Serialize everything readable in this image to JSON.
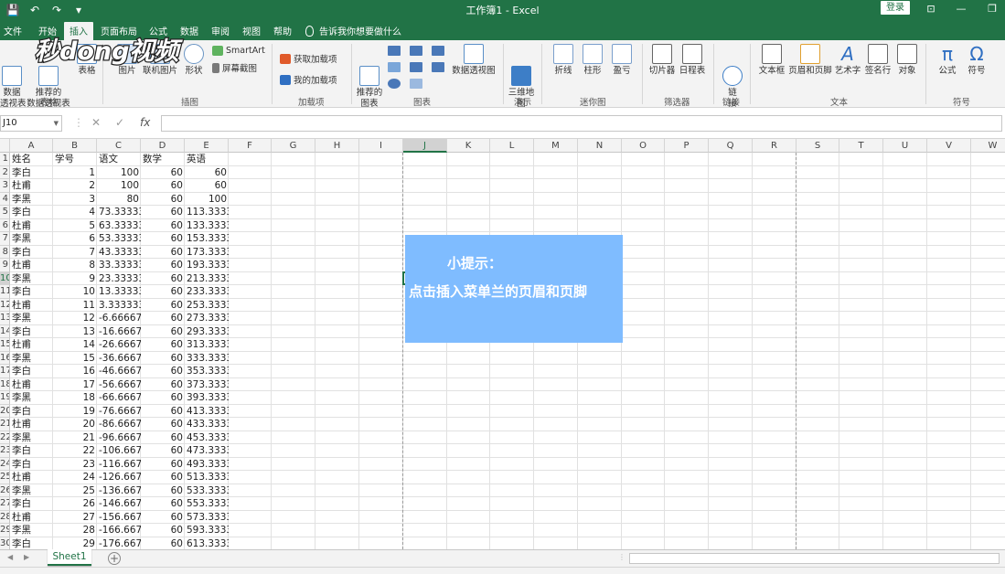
{
  "titlebar": {
    "title": "工作簿1 - Excel",
    "login": "登录",
    "qat": [
      "💾",
      "↶",
      "↷",
      "▾"
    ],
    "win": [
      "⊡",
      "—",
      "❐"
    ]
  },
  "menu": {
    "tabs": [
      "文件",
      "开始",
      "插入",
      "页面布局",
      "公式",
      "数据",
      "审阅",
      "视图",
      "帮助"
    ],
    "tellme": "告诉我你想要做什么"
  },
  "ribbon": {
    "buttons": {
      "pivot": "数据\n透视表",
      "rec_pivot": "推荐的\n数据透视表",
      "table": "表格",
      "picture": "图片",
      "online_pic": "联机图片",
      "shapes": "形状",
      "smartart": "SmartArt",
      "screenshot": "屏幕截图",
      "get_addins": "获取加载项",
      "my_addins": "我的加载项",
      "rec_charts": "推荐的\n图表",
      "pivot_chart": "数据透视图",
      "map3d": "三维地\n图",
      "line": "折线",
      "column": "柱形",
      "winloss": "盈亏",
      "slicer": "切片器",
      "timeline": "日程表",
      "link": "链\n接",
      "textbox": "文本框",
      "header_footer": "页眉和页脚",
      "wordart": "艺术字",
      "signature": "签名行",
      "object": "对象",
      "equation": "公式",
      "symbol": "符号"
    },
    "groups": {
      "tables": "表格",
      "illustrations": "插图",
      "addins": "加载项",
      "charts": "图表",
      "tours": "演示",
      "sparklines": "迷你图",
      "filters": "筛选器",
      "links": "链接",
      "text": "文本",
      "symbols": "符号"
    }
  },
  "logo": {
    "text": "秒dong视频"
  },
  "formula": {
    "namebox": "J10",
    "cancel": "✕",
    "enter": "✓",
    "fx": "fx",
    "value": ""
  },
  "grid": {
    "columns": [
      "A",
      "B",
      "C",
      "D",
      "E",
      "F",
      "G",
      "H",
      "I",
      "J",
      "K",
      "L",
      "M",
      "N",
      "O",
      "P",
      "Q",
      "R",
      "S",
      "T",
      "U",
      "V",
      "W"
    ],
    "row_headers": [
      "1",
      "2",
      "3",
      "4",
      "5",
      "6",
      "7",
      "8",
      "9",
      "10",
      "11",
      "12",
      "13",
      "14",
      "15",
      "16",
      "17",
      "18",
      "19",
      "20",
      "21",
      "22",
      "23",
      "24",
      "25",
      "26",
      "27",
      "28",
      "29",
      "30"
    ],
    "header": [
      "姓名",
      "学号",
      "语文",
      "数学",
      "英语"
    ],
    "rows": [
      [
        "李白",
        "1",
        "100",
        "60",
        "60"
      ],
      [
        "杜甫",
        "2",
        "100",
        "60",
        "60"
      ],
      [
        "李黑",
        "3",
        "80",
        "60",
        "100"
      ],
      [
        "李白",
        "4",
        "73.33333",
        "60",
        "113.3333"
      ],
      [
        "杜甫",
        "5",
        "63.33333",
        "60",
        "133.3333"
      ],
      [
        "李黑",
        "6",
        "53.33333",
        "60",
        "153.3333"
      ],
      [
        "李白",
        "7",
        "43.33333",
        "60",
        "173.3333"
      ],
      [
        "杜甫",
        "8",
        "33.33333",
        "60",
        "193.3333"
      ],
      [
        "李黑",
        "9",
        "23.33333",
        "60",
        "213.3333"
      ],
      [
        "李白",
        "10",
        "13.33333",
        "60",
        "233.3333"
      ],
      [
        "杜甫",
        "11",
        "3.333333",
        "60",
        "253.3333"
      ],
      [
        "李黑",
        "12",
        "-6.66667",
        "60",
        "273.3333"
      ],
      [
        "李白",
        "13",
        "-16.6667",
        "60",
        "293.3333"
      ],
      [
        "杜甫",
        "14",
        "-26.6667",
        "60",
        "313.3333"
      ],
      [
        "李黑",
        "15",
        "-36.6667",
        "60",
        "333.3333"
      ],
      [
        "李白",
        "16",
        "-46.6667",
        "60",
        "353.3333"
      ],
      [
        "杜甫",
        "17",
        "-56.6667",
        "60",
        "373.3333"
      ],
      [
        "李黑",
        "18",
        "-66.6667",
        "60",
        "393.3333"
      ],
      [
        "李白",
        "19",
        "-76.6667",
        "60",
        "413.3333"
      ],
      [
        "杜甫",
        "20",
        "-86.6667",
        "60",
        "433.3333"
      ],
      [
        "李黑",
        "21",
        "-96.6667",
        "60",
        "453.3333"
      ],
      [
        "李白",
        "22",
        "-106.667",
        "60",
        "473.3333"
      ],
      [
        "李白",
        "23",
        "-116.667",
        "60",
        "493.3333"
      ],
      [
        "杜甫",
        "24",
        "-126.667",
        "60",
        "513.3333"
      ],
      [
        "李黑",
        "25",
        "-136.667",
        "60",
        "533.3333"
      ],
      [
        "李白",
        "26",
        "-146.667",
        "60",
        "553.3333"
      ],
      [
        "杜甫",
        "27",
        "-156.667",
        "60",
        "573.3333"
      ],
      [
        "李黑",
        "28",
        "-166.667",
        "60",
        "593.3333"
      ],
      [
        "李白",
        "29",
        "-176.667",
        "60",
        "613.3333"
      ]
    ]
  },
  "tip": {
    "title": "小提示：",
    "body": "点击插入菜单兰的页眉和页脚"
  },
  "sheets": {
    "tabs": [
      "Sheet1"
    ],
    "add": "+",
    "nav_prev": "◀",
    "nav_next": "▶"
  }
}
